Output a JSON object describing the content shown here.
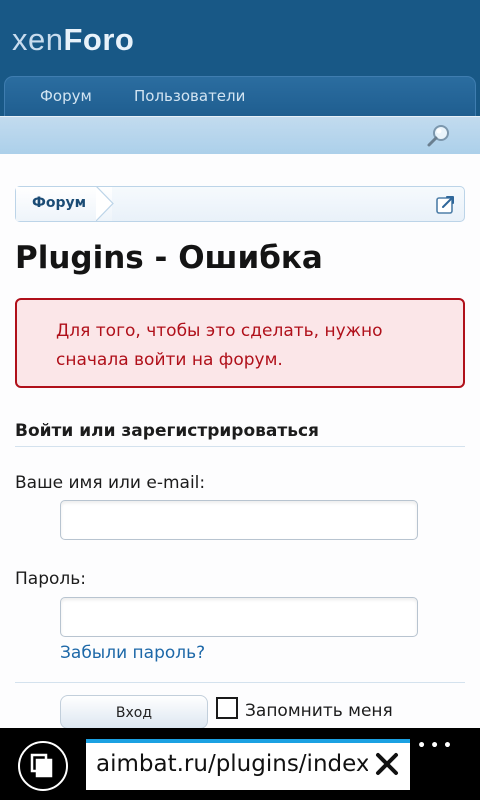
{
  "app": {
    "logo_prefix": "xen",
    "logo_suffix": "Foro"
  },
  "nav": {
    "tabs": [
      {
        "label": "Форум"
      },
      {
        "label": "Пользователи"
      }
    ]
  },
  "breadcrumb": {
    "items": [
      {
        "label": "Форум"
      }
    ]
  },
  "page": {
    "title": "Plugins - Ошибка"
  },
  "error": {
    "message": "Для того, чтобы это сделать, нужно сначала войти на форум."
  },
  "login": {
    "section_title": "Войти или зарегистрироваться",
    "username_label": "Ваше имя или e-mail:",
    "username_value": "",
    "password_label": "Пароль:",
    "password_value": "",
    "forgot_label": "Забыли пароль?",
    "submit_label": "Вход",
    "remember_label": "Запомнить меня",
    "remember_checked": false
  },
  "browser": {
    "url": "aimbat.ru/plugins/index.",
    "menu_glyph": "•••"
  },
  "colors": {
    "header_bg": "#185886",
    "subnav_bg": "#b7d6ec",
    "error_border": "#b0101a",
    "error_bg": "#fbe6e8",
    "link": "#1d68a8",
    "accent_browser": "#1ba1e2"
  }
}
